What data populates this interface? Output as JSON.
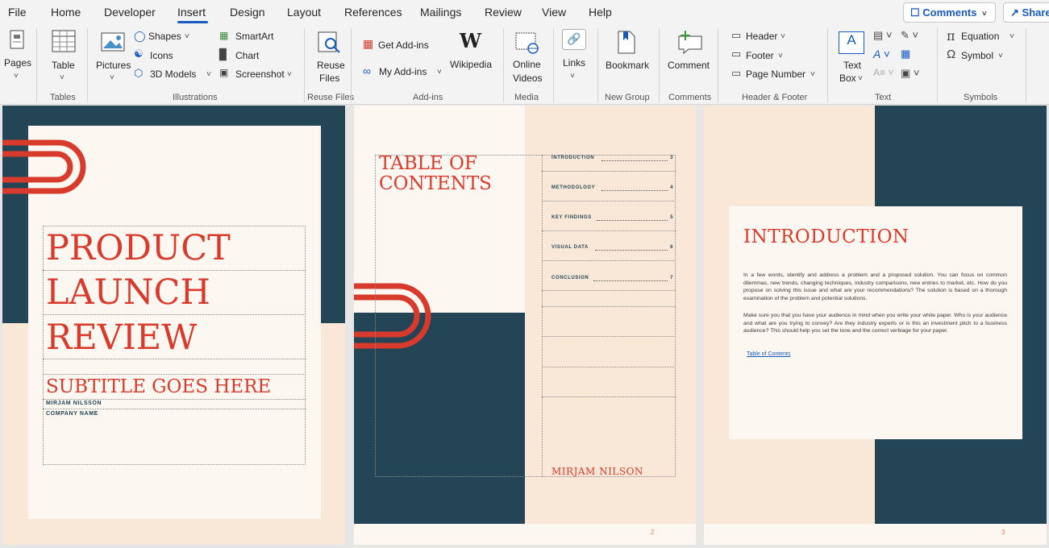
{
  "menu": {
    "file": "File",
    "home": "Home",
    "developer": "Developer",
    "insert": "Insert",
    "design": "Design",
    "layout": "Layout",
    "references": "References",
    "mailings": "Mailings",
    "review": "Review",
    "view": "View",
    "help": "Help",
    "comments_btn": "Comments",
    "share_btn": "Share"
  },
  "ribbon": {
    "pages": "Pages",
    "table": "Table",
    "tables_group": "Tables",
    "pictures": "Pictures",
    "shapes": "Shapes",
    "icons": "Icons",
    "models3d": "3D Models",
    "smartart": "SmartArt",
    "chart": "Chart",
    "screenshot": "Screenshot",
    "illustrations_group": "Illustrations",
    "reuse_files_1": "Reuse",
    "reuse_files_2": "Files",
    "reuse_files_group": "Reuse Files",
    "get_addins": "Get Add-ins",
    "my_addins": "My Add-ins",
    "wikipedia": "Wikipedia",
    "addins_group": "Add-ins",
    "online_1": "Online",
    "online_2": "Videos",
    "media_group": "Media",
    "links": "Links",
    "bookmark": "Bookmark",
    "newgroup_group": "New Group",
    "comment": "Comment",
    "comments_group": "Comments",
    "header": "Header",
    "footer": "Footer",
    "page_number": "Page Number",
    "hf_group": "Header & Footer",
    "textbox_1": "Text",
    "textbox_2": "Box",
    "text_group": "Text",
    "equation": "Equation",
    "symbol": "Symbol",
    "symbols_group": "Symbols"
  },
  "doc": {
    "cover": {
      "title_1": "PRODUCT",
      "title_2": "LAUNCH",
      "title_3": "REVIEW",
      "subtitle": "SUBTITLE GOES HERE",
      "author": "MIRJAM NILSSON",
      "company": "COMPANY NAME"
    },
    "toc": {
      "heading_1": "TABLE OF",
      "heading_2": "CONTENTS",
      "entries": [
        {
          "label": "INTRODUCTION",
          "page": "3"
        },
        {
          "label": "METHODOLOGY",
          "page": "4"
        },
        {
          "label": "KEY FINDINGS",
          "page": "5"
        },
        {
          "label": "VISUAL DATA",
          "page": "6"
        },
        {
          "label": "CONCLUSION",
          "page": "7"
        }
      ],
      "author": "MIRJAM NILSON",
      "page_num": "2"
    },
    "intro": {
      "heading": "INTRODUCTION",
      "para_1": "In a few words, identify and address a problem and a proposed solution. You can focus on common dilemmas, new trends, changing techniques, industry comparisons, new entries to market, etc. How do you propose on solving this issue and what are your recommendations? The solution is based on a thorough examination of the problem and potential solutions.",
      "para_2": "Make sure you that you have your audience in mind when you write your white paper. Who is your audience and what are you trying to convey? Are they industry experts or is this an investment pitch to a business audience? This should help you set the tone and the correct verbiage for your paper.",
      "link": "Table of Contents",
      "page_num": "3"
    }
  },
  "colors": {
    "accent_red": "#d83b2c",
    "navy": "#244555",
    "cream": "#fdf7f1",
    "peach": "#f9e8d8",
    "ribbon_blue": "#185abd"
  }
}
